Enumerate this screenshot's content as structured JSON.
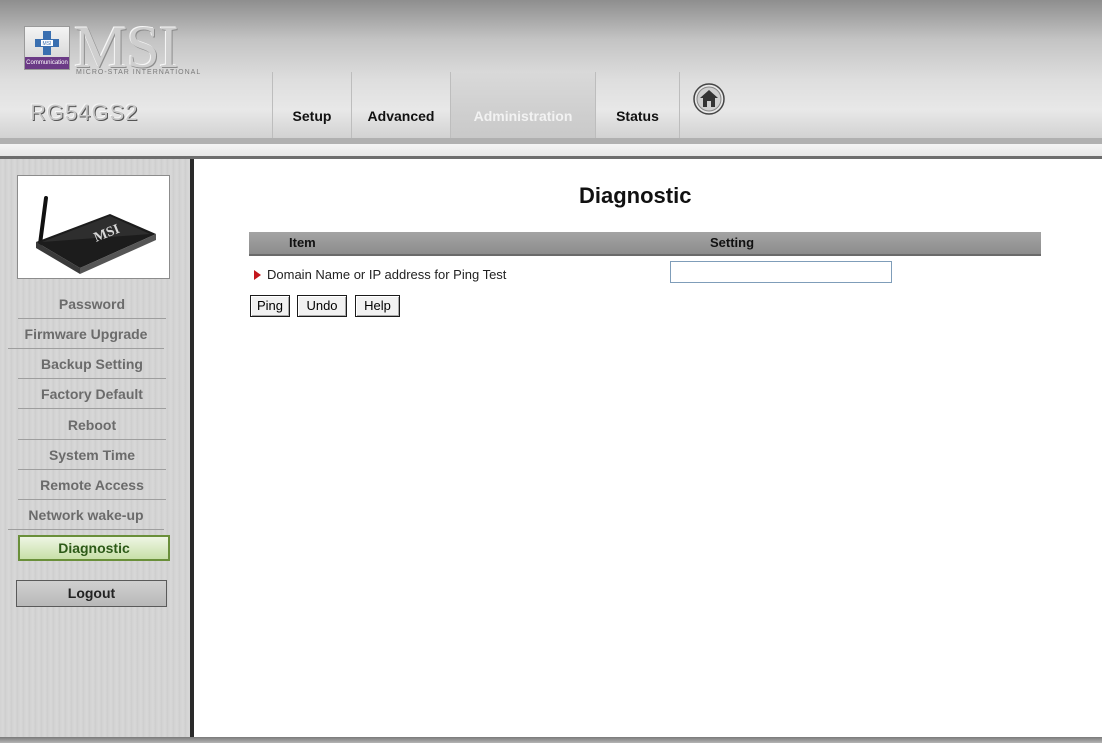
{
  "brand": {
    "name": "MSI",
    "tagline": "MICRO-STAR INTERNATIONAL",
    "logo_badge": "Communication",
    "logo_emblem": "MSI",
    "model": "RG54GS2"
  },
  "tabs": [
    {
      "label": "Setup",
      "active": false
    },
    {
      "label": "Advanced",
      "active": false
    },
    {
      "label": "Administration",
      "active": true
    },
    {
      "label": "Status",
      "active": false
    }
  ],
  "home_icon": "home-icon",
  "sidebar": {
    "device_image": "router-image",
    "items": [
      {
        "label": "Password",
        "active": false
      },
      {
        "label": "Firmware Upgrade",
        "active": false
      },
      {
        "label": "Backup Setting",
        "active": false
      },
      {
        "label": "Factory Default",
        "active": false
      },
      {
        "label": "Reboot",
        "active": false
      },
      {
        "label": "System Time",
        "active": false
      },
      {
        "label": "Remote Access",
        "active": false
      },
      {
        "label": "Network wake-up",
        "active": false
      },
      {
        "label": "Diagnostic",
        "active": true
      }
    ],
    "logout_label": "Logout"
  },
  "main": {
    "title": "Diagnostic",
    "table": {
      "col_item": "Item",
      "col_setting": "Setting",
      "rows": [
        {
          "label": "Domain Name or IP address for Ping Test",
          "value": ""
        }
      ]
    },
    "buttons": {
      "ping": "Ping",
      "undo": "Undo",
      "help": "Help"
    }
  },
  "colors": {
    "active_nav_bg": "#c8e0a8",
    "active_nav_border": "#6a8f3a",
    "row_arrow": "#c4161c",
    "table_header": "#9a9a9a"
  }
}
